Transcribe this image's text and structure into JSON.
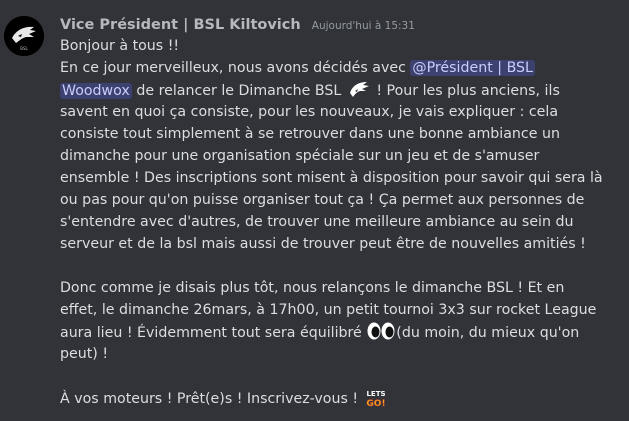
{
  "message": {
    "author": "Vice Président | BSL Kiltovich",
    "timestamp": "Aujourd'hui à 15:31",
    "avatar_icon": "wolf-logo-icon",
    "lines": {
      "l1": "Bonjour à tous !!",
      "l2_before": "En ce jour merveilleux, nous avons décidés avec ",
      "mention_part1": "@Président  | BSL",
      "mention_part2": "Woodwox",
      "l3_after": " de relancer le Dimanche BSL ",
      "l3_end": " ! Pour les plus anciens, ils",
      "l4": "savent en quoi ça consiste, pour les nouveaux, je vais expliquer : cela",
      "l5": "consiste tout simplement à se retrouver dans une bonne ambiance un",
      "l6": "dimanche pour une organisation spéciale sur un jeu et de s'amuser",
      "l7": "ensemble ! Des inscriptions sont misent à disposition pour savoir qui sera là",
      "l8": "ou pas pour qu'on puisse organiser tout ça ! Ça permet aux personnes de",
      "l9": "s'entendre avec d'autres, de trouver une meilleure ambiance au sein du",
      "l10": "serveur et de la bsl mais aussi de trouver peut être de nouvelles amitiés !",
      "l11": "Donc comme je disais plus tôt, nous relançons le dimanche BSL ! Et en",
      "l12": "effet, le dimanche 26mars, à 17h00, un petit tournoi 3x3 sur rocket League",
      "l13_before": "aura lieu ! Évidemment tout sera équilibré ",
      "l13_after": "(du moin, du mieux qu'on",
      "l14": "peut) !",
      "l15": "À vos moteurs ! Prêt(e)s ! Inscrivez-vous ! "
    },
    "emojis": {
      "wolf": "wolf-emoji-icon",
      "eyes": "eyes-emoji-icon",
      "letsgo": "lets-go-emoji-icon",
      "letsgo_text_top": "LETS",
      "letsgo_text_bottom": "GO!"
    },
    "colors": {
      "background": "#313338",
      "text": "#dbdee1",
      "author": "#b5b9bf",
      "timestamp": "#949ba4",
      "mention_bg": "#3c4270",
      "mention_text": "#c9cdfb"
    }
  }
}
